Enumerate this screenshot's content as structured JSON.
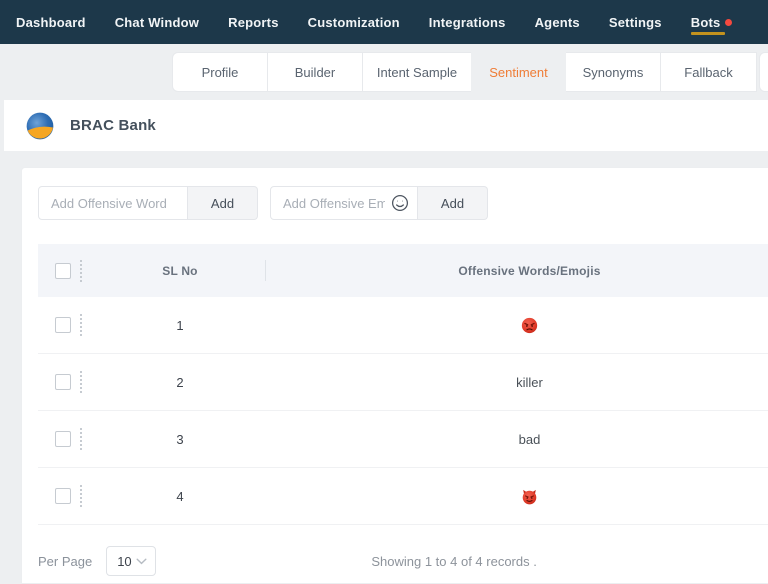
{
  "colors": {
    "navbar_bg": "#1d384a",
    "accent_orange": "#ef7d37",
    "active_underline_gold": "#c3921e",
    "notification_red": "#f4493f",
    "page_bg": "#edeff1",
    "table_header_bg": "#f3f5f9",
    "logo_blue": "#2e6db4",
    "logo_orange": "#f5a623"
  },
  "navbar": {
    "items": [
      {
        "label": "Dashboard"
      },
      {
        "label": "Chat Window"
      },
      {
        "label": "Reports"
      },
      {
        "label": "Customization"
      },
      {
        "label": "Integrations"
      },
      {
        "label": "Agents"
      },
      {
        "label": "Settings"
      },
      {
        "label": "Bots",
        "active": true,
        "has_notification_dot": true
      }
    ]
  },
  "tabs": {
    "items": [
      {
        "label": "Profile"
      },
      {
        "label": "Builder"
      },
      {
        "label": "Intent Sample"
      },
      {
        "label": "Sentiment",
        "active": true
      },
      {
        "label": "Synonyms"
      },
      {
        "label": "Fallback"
      }
    ]
  },
  "brand": {
    "name": "BRAC Bank",
    "logo": "brac-bank-logo"
  },
  "forms": {
    "word_input": {
      "placeholder": "Add Offensive Word",
      "value": ""
    },
    "word_add_button": "Add",
    "emoji_input": {
      "placeholder": "Add Offensive Emoji",
      "value": "",
      "icon": "smiley-icon"
    },
    "emoji_add_button": "Add"
  },
  "table": {
    "columns": {
      "sl_no": "SL No",
      "offensive": "Offensive Words/Emojis"
    },
    "rows": [
      {
        "sl": "1",
        "value_type": "emoji",
        "value": "pouting-face-emoji"
      },
      {
        "sl": "2",
        "value_type": "text",
        "value": "killer"
      },
      {
        "sl": "3",
        "value_type": "text",
        "value": "bad"
      },
      {
        "sl": "4",
        "value_type": "emoji",
        "value": "angry-face-with-horns-emoji"
      }
    ]
  },
  "pagination": {
    "per_page_label": "Per Page",
    "per_page_value": "10",
    "summary": "Showing 1 to 4 of 4 records ."
  }
}
